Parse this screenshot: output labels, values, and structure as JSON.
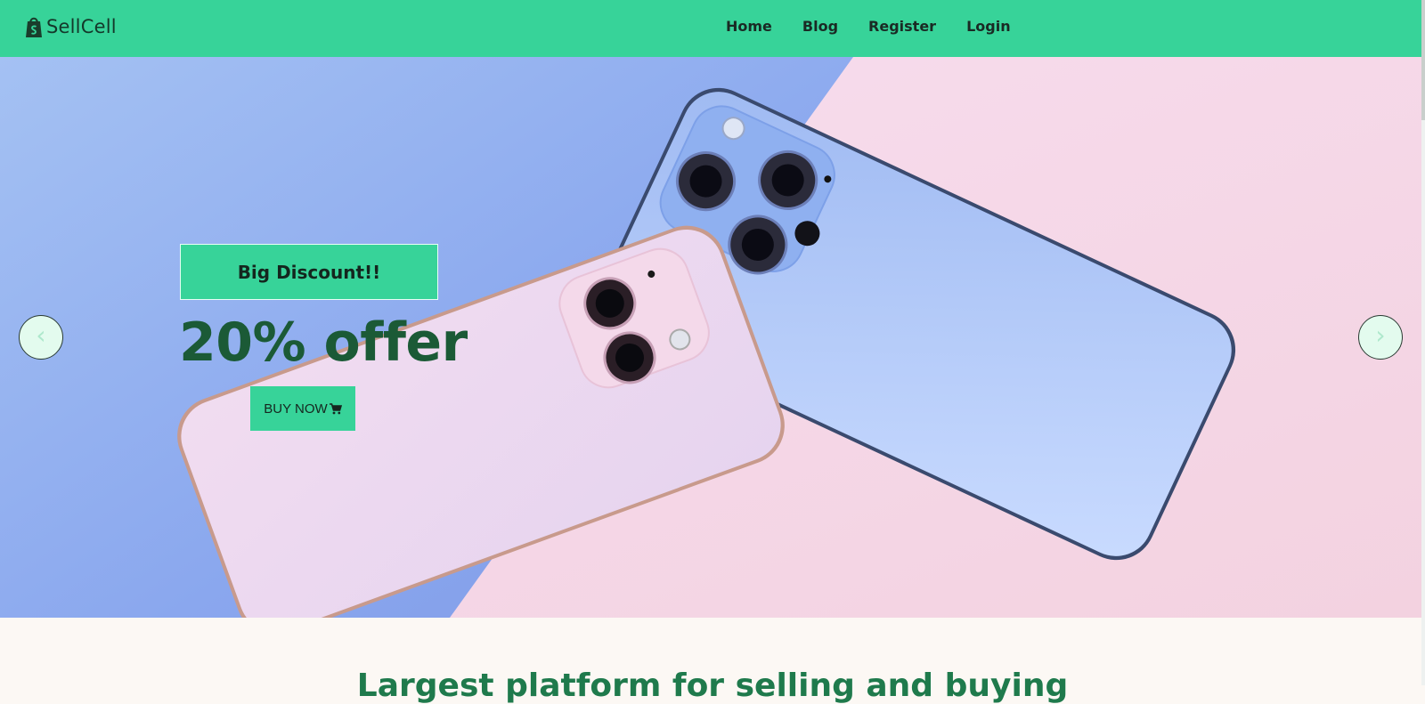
{
  "navbar": {
    "brand": "SellCell",
    "brand_icon": "shopify-bag-icon",
    "links": [
      {
        "label": "Home"
      },
      {
        "label": "Blog"
      },
      {
        "label": "Register"
      },
      {
        "label": "Login"
      }
    ]
  },
  "hero": {
    "badge": "Big Discount!!",
    "offer": "20% offer",
    "buy_button": "BUY NOW",
    "buy_icon": "cart-icon",
    "prev_label": "‹",
    "next_label": "›",
    "image": "two-iphones-on-blue-pink-background"
  },
  "section": {
    "heading": "Largest platform for selling and buying"
  },
  "colors": {
    "accent": "#37d399",
    "offer_text": "#1b5a36",
    "section_bg": "#fcf8f4"
  }
}
